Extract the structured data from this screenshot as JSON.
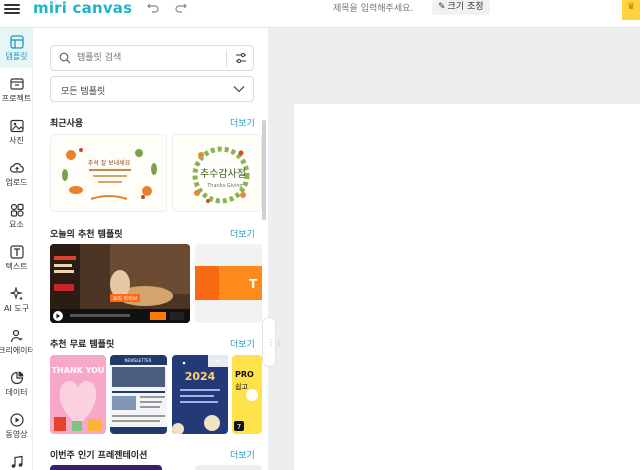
{
  "app": {
    "logo_text": "miri canvas",
    "doc_title_placeholder": "제목을 입력해주세요.",
    "resize_label": "크기 조정",
    "colors": {
      "accent": "#1fb5c9",
      "link": "#1a9db3",
      "canvas": "#eceef0"
    }
  },
  "rail": {
    "items": [
      {
        "label": "템플릿",
        "icon": "template-icon",
        "active": true
      },
      {
        "label": "프로젝트",
        "icon": "project-icon"
      },
      {
        "label": "사진",
        "icon": "photo-icon"
      },
      {
        "label": "업로드",
        "icon": "upload-cloud-icon"
      },
      {
        "label": "요소",
        "icon": "elements-icon"
      },
      {
        "label": "텍스트",
        "icon": "text-icon"
      },
      {
        "label": "AI 도구",
        "icon": "ai-sparkle-icon"
      },
      {
        "label": "크리에이터",
        "icon": "creator-icon"
      },
      {
        "label": "데이터",
        "icon": "data-chart-icon"
      },
      {
        "label": "동영상",
        "icon": "video-icon"
      },
      {
        "label": "",
        "icon": "music-icon"
      }
    ]
  },
  "panel": {
    "search_placeholder": "템플릿 검색",
    "dropdown_value": "모든 템플릿",
    "sections": {
      "recent": {
        "title": "최근사용",
        "more": "더보기"
      },
      "today": {
        "title": "오늘의 추천 템플릿",
        "more": "더보기"
      },
      "free": {
        "title": "추천 무료 템플릿",
        "more": "더보기"
      },
      "weekly": {
        "title": "이번주 인기 프레젠테이션",
        "more": "더보기"
      }
    },
    "recent_thumbs": [
      {
        "text": "추석 잘 보내세요"
      },
      {
        "text": "추수감사절",
        "subtext": "Thanks Giving"
      }
    ],
    "today_thumbs": [
      {
        "text": "요리 라이브"
      },
      {
        "text": "T"
      }
    ],
    "free_thumbs": [
      {
        "text": "THANK YOU"
      },
      {
        "text": "NEWSLETTER"
      },
      {
        "text": "2024"
      },
      {
        "text": "PRO",
        "subtext": "쉽고",
        "badge": "7"
      }
    ]
  }
}
